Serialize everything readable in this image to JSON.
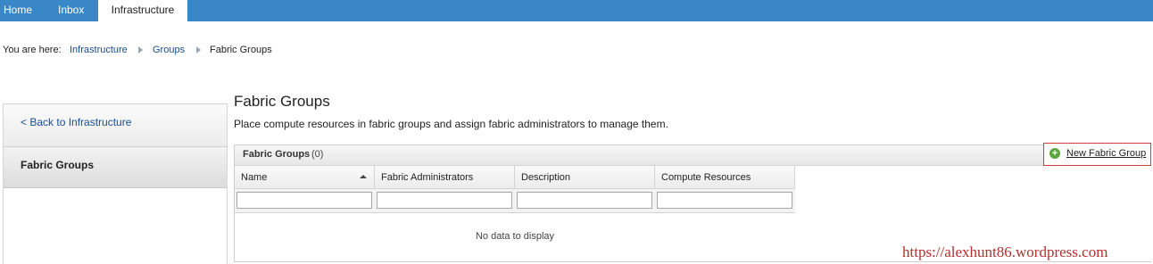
{
  "nav": {
    "tabs": [
      {
        "label": "Home",
        "active": false
      },
      {
        "label": "Inbox",
        "active": false
      },
      {
        "label": "Infrastructure",
        "active": true
      }
    ]
  },
  "breadcrumb": {
    "prefix": "You are here:",
    "items": [
      "Infrastructure",
      "Groups",
      "Fabric Groups"
    ]
  },
  "sidebar": {
    "back_label": "< Back to Infrastructure",
    "current_label": "Fabric Groups"
  },
  "page": {
    "title": "Fabric Groups",
    "description": "Place compute resources in fabric groups and assign fabric administrators to manage them."
  },
  "grid": {
    "title": "Fabric Groups",
    "count": "(0)",
    "new_button_label": "New Fabric Group",
    "columns": [
      "Name",
      "Fabric Administrators",
      "Description",
      "Compute Resources"
    ],
    "sorted_column": "Name",
    "sort_direction": "ascending",
    "empty_message": "No data to display"
  },
  "watermark": "https://alexhunt86.wordpress.com",
  "colors": {
    "nav_bar": "#3a87c8",
    "link": "#1a4d8f",
    "button_border_highlight": "#d23c3c",
    "add_icon": "#5ba63c",
    "watermark": "#b23030"
  }
}
